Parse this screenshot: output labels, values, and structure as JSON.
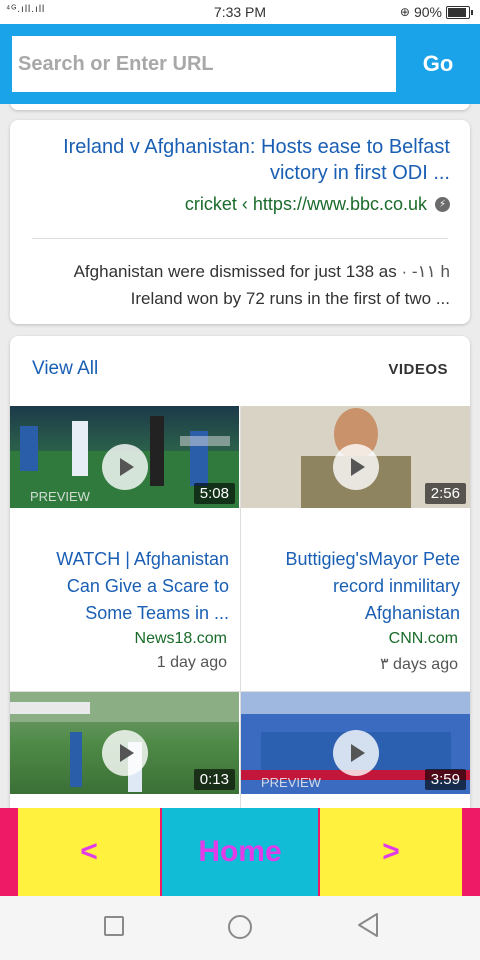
{
  "status_bar": {
    "signal": "⁴ᴳ.ıll.ıll",
    "time": "7:33 PM",
    "battery": "90%"
  },
  "url_bar": {
    "placeholder": "Search or Enter URL",
    "value": "",
    "go_label": "Go"
  },
  "news_card": {
    "title": "Ireland v Afghanistan: Hosts ease to Belfast victory in first ODI ...",
    "source": "cricket ‹ https://www.bbc.co.uk",
    "snippet_line1": "Afghanistan were dismissed for just 138 as",
    "snippet_time": " · -١١ h",
    "snippet_line2": "Ireland won by 72 runs in the first of two ..."
  },
  "videos": {
    "view_all": "View All",
    "label": "VIDEOS",
    "items": [
      {
        "title": "WATCH | Afghanistan Can Give a Scare to Some Teams in ...",
        "source": "News18.com",
        "age": "1 day ago",
        "duration": "5:08",
        "preview": "PREVIEW"
      },
      {
        "title": "Buttigieg'sMayor Pete record inmilitary Afghanistan",
        "source": "CNN.com",
        "age": "٣ days ago",
        "duration": "2:56",
        "preview": ""
      },
      {
        "title": "",
        "source": "",
        "age": "",
        "duration": "0:13",
        "preview": ""
      },
      {
        "title": "",
        "source": "",
        "age": "",
        "duration": "3:59",
        "preview": "PREVIEW"
      }
    ]
  },
  "bottom_nav": {
    "back": "<",
    "home": "Home",
    "forward": ">"
  },
  "colors": {
    "accent": "#1aa3e8",
    "nav_bg": "#ef1a66",
    "nav_yellow": "#fff13d",
    "nav_cyan": "#10bcd6",
    "nav_text": "#e23ce8",
    "link": "#1a5fb4",
    "source": "#1a6b2a"
  },
  "icons": {
    "amp": "lightning-icon",
    "play": "play-icon",
    "recents": "square-icon",
    "home": "circle-icon",
    "back": "triangle-back-icon"
  }
}
